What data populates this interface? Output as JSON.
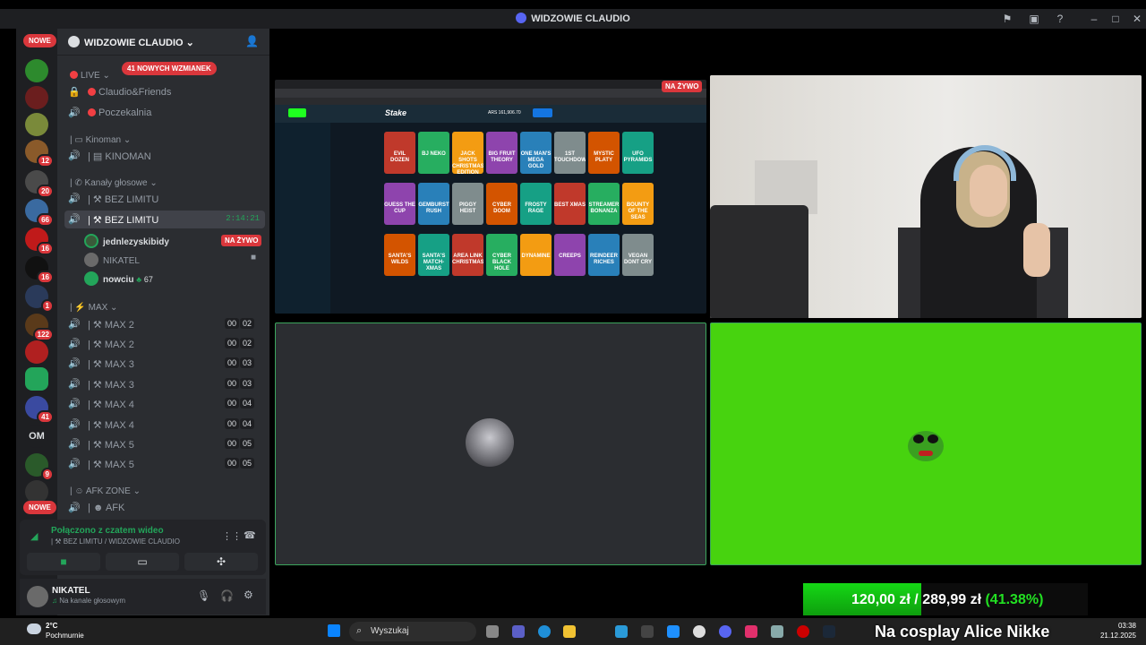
{
  "window": {
    "title": "WIDZOWIE CLAUDIO"
  },
  "rail": {
    "new_top": "NOWE",
    "new_bottom": "NOWE",
    "om_label": "OM",
    "badges": [
      "12",
      "20",
      "66",
      "16",
      "16",
      "1",
      "122",
      "41",
      "9"
    ]
  },
  "server": {
    "name": "WIDZOWIE CLAUDIO"
  },
  "mentions_pill": "41 NOWYCH WZMIANEK",
  "categories": {
    "live": "LIVE",
    "kinoman": "Kinoman",
    "voice": "Kanały głosowe",
    "max": "MAX",
    "afk": "AFK ZONE"
  },
  "channels": {
    "claudio_friends": "Claudio&Friends",
    "poczekalnia": "Poczekalnia",
    "kinoman_ch": "KINOMAN",
    "bez_limitu_1": "BEZ LIMITU",
    "bez_limitu_2": "BEZ LIMITU",
    "timer": "2:14:21",
    "max": [
      {
        "name": "MAX 2",
        "a": "00",
        "b": "02"
      },
      {
        "name": "MAX 2",
        "a": "00",
        "b": "02"
      },
      {
        "name": "MAX 3",
        "a": "00",
        "b": "03"
      },
      {
        "name": "MAX 3",
        "a": "00",
        "b": "03"
      },
      {
        "name": "MAX 4",
        "a": "00",
        "b": "04"
      },
      {
        "name": "MAX 4",
        "a": "00",
        "b": "04"
      },
      {
        "name": "MAX 5",
        "a": "00",
        "b": "05"
      },
      {
        "name": "MAX 5",
        "a": "00",
        "b": "05"
      }
    ],
    "afk": "AFK"
  },
  "voice_users": [
    {
      "name": "jednlezyskibidy",
      "live": "NA ŻYWO"
    },
    {
      "name": "NIKATEL"
    },
    {
      "name": "nowciu",
      "extra": "67"
    }
  ],
  "voice_status": {
    "title": "Połączono z czatem wideo",
    "subtitle": "BEZ LIMITU / WIDZOWIE CLAUDIO"
  },
  "userbar": {
    "name": "NIKATEL",
    "status": "Na kanale głosowym"
  },
  "stage": {
    "live_label": "NA ŻYWO"
  },
  "stream": {
    "site": "Stake",
    "balance": "ARS 161,906.70",
    "games": [
      "EVIL DOZEN",
      "BJ NEKO",
      "JACK SHOTS CHRISTMAS EDITION",
      "BIG FRUIT THEORY",
      "ONE MAN'S MEGA GOLD",
      "1ST TOUCHDOWN",
      "MYSTIC PLATY",
      "UFO PYRAMIDS",
      "GUESS THE CUP",
      "GEMBURST RUSH",
      "PIGGY HEIST",
      "CYBER DOOM",
      "FROSTY RAGE",
      "BEST XMAS",
      "STREAMER BONANZA",
      "BOUNTY OF THE SEAS",
      "SANTA'S WILDS",
      "SANTA'S MATCH-XMAS",
      "AREA LINK CHRISTMAS",
      "CYBER BLACK HOLE",
      "DYNAMINE",
      "CREEPS",
      "REINDEER RICHES",
      "VEGAN DONT CRY"
    ]
  },
  "donation": {
    "amount": "120,00 zł",
    "sep": "/",
    "goal": "289,99 zł",
    "pct": "(41.38%)",
    "progress": 0.4138,
    "caption": "Na cosplay Alice Nikke"
  },
  "taskbar": {
    "weather_temp": "2°C",
    "weather_desc": "Pochmurnie",
    "search": "Wyszukaj",
    "time": "03:38",
    "date": "21.12.2025"
  },
  "colors": {
    "accent": "#5865f2",
    "green": "#23a55a",
    "red": "#da373c",
    "greenscreen": "#47d30f"
  }
}
